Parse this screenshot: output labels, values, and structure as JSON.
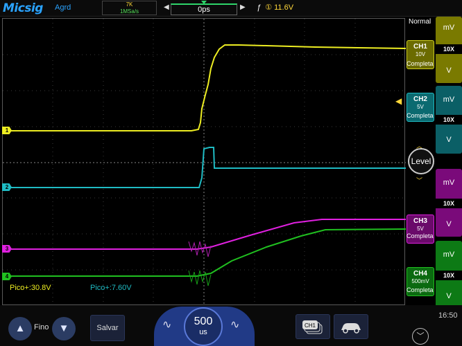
{
  "topbar": {
    "brand": "Micsig",
    "acquire_mode": "Agrd",
    "memory_depth": "7K",
    "sample_rate": "1MSa/s",
    "trigger_position": "0ps",
    "trigger_source": "①",
    "trigger_level": "11.6V"
  },
  "trigger": {
    "mode": "Normal",
    "level_button": "Level"
  },
  "channels": [
    {
      "id": "CH1",
      "scale": "10V",
      "coupling_label": "Completa",
      "probe": "10X",
      "unit_top": "mV",
      "unit_bottom": "V",
      "color": "#eeee22",
      "marker": "1"
    },
    {
      "id": "CH2",
      "scale": "5V",
      "coupling_label": "Completa",
      "probe": "10X",
      "unit_top": "mV",
      "unit_bottom": "V",
      "color": "#1fbcc4",
      "marker": "2"
    },
    {
      "id": "CH3",
      "scale": "5V",
      "coupling_label": "Completa",
      "probe": "10X",
      "unit_top": "mV",
      "unit_bottom": "V",
      "color": "#e020e0",
      "marker": "3"
    },
    {
      "id": "CH4",
      "scale": "500mV",
      "coupling_label": "Completa",
      "probe": "10X",
      "unit_top": "mV",
      "unit_bottom": "V",
      "color": "#20c020",
      "marker": "4"
    }
  ],
  "measurements": {
    "ch1_peak": "Pico+:30.8V",
    "ch2_peak": "Pico+:7.60V"
  },
  "bottom": {
    "fine_label": "Fino",
    "save_label": "Salvar",
    "timebase_value": "500",
    "timebase_unit": "us",
    "channel_button": "CH1",
    "clock": "16:50"
  }
}
